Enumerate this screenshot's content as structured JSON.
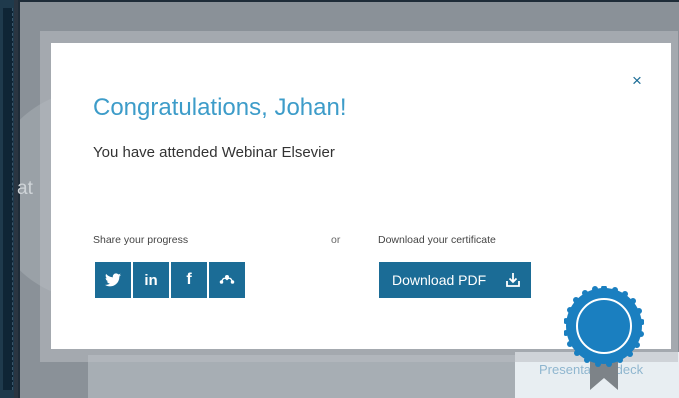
{
  "background": {
    "partial_text": "at",
    "presentation_deck_text": "Presentation deck"
  },
  "modal": {
    "close_icon": "×",
    "title": "Congratulations, Johan!",
    "subtitle": "You have attended Webinar Elsevier",
    "share_label": "Share your progress",
    "or_label": "or",
    "download_label": "Download your certificate",
    "download_button_label": "Download PDF",
    "social_icons": [
      "twitter-icon",
      "linkedin-icon",
      "facebook-icon",
      "mendeley-icon"
    ],
    "linkedin_text": "in",
    "facebook_text": "f"
  },
  "colors": {
    "accent": "#1b6c96",
    "title": "#3d9cc9",
    "badge": "#1a7fc0"
  }
}
